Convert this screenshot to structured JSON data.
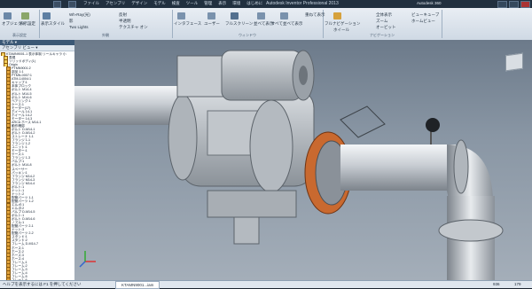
{
  "window": {
    "title": "Autodesk Inventor Professional 2013   ",
    "menus": [
      "ファイル",
      "アセンブリ",
      "デザイン",
      "モデル",
      "検査",
      "ツール",
      "管理",
      "表示",
      "環境",
      "はじめに"
    ],
    "right_label": "Autodesk 360"
  },
  "ribbon": {
    "groups": [
      {
        "title": "表示設定",
        "buttons": [
          "オブジェクト",
          "表示設定"
        ]
      },
      {
        "title": "外観",
        "buttons": [
          "表示スタイル",
          "Wh-Ray(光)",
          "影",
          "Two Lights",
          "反射",
          "半透明",
          "テクスチャ オン"
        ]
      },
      {
        "title": "ウィンドウ",
        "buttons": [
          "インタフェース",
          "ユーザー",
          "フルスクリーン",
          "並べて表示",
          "すべて並べて表示",
          "重ねて表示"
        ]
      },
      {
        "title": "ナビゲーション",
        "buttons": [
          "フルナビゲーション",
          "ホイール",
          "全体表示",
          "ズーム",
          "オービット",
          "ビューキューブ",
          "ホームビュー"
        ]
      }
    ]
  },
  "browser": {
    "header": "モデル ▾",
    "subheader": "アセンブリ ビュー ▾",
    "items": [
      "KTAMN9001-1 表示体制 リールキャラ 小",
      "表現",
      "ソリッドボディ(1)",
      "Origin",
      "PTMN9001:2",
      "部品 1:1",
      "PTMN-0007:1",
      "ATM-14004:1",
      "キャップ:1",
      "本体ブロック",
      "ボルト M14-4",
      "ボルト M14-5",
      "ボルト M14-6",
      "ベアリング:1",
      "ケース:1",
      "モーター(17)",
      "ホイール 14-1",
      "ホイール 14-2",
      "モーター 14-3",
      "ARCA ホース M14-1",
      "動作確認",
      "ボルト D-M14-1",
      "ボルト D-M14-2",
      "ストレーナ 1-1",
      "フランジ 1-1",
      "フランジ 1-2",
      "ユニット:1",
      "モーター:1",
      "ケース:1",
      "フランジ 1-3",
      "バルブ:1",
      "ボルト M14-8",
      "スペーサー",
      "パッキン:1",
      "フランジ M14-2",
      "フランジ M14-3",
      "フランジ M14-4",
      "ボルト:1",
      "ナット:1",
      "ナット:2",
      "配管パーツ 1-1",
      "配管パーツ 1-2",
      "エルボ:1",
      "エルボ:2",
      "バルブ D-M14-5",
      "ボルト:1",
      "ボルト D-M14-6",
      "ノズル:1",
      "配管パーツ 2-1",
      "ナット:3",
      "配管パーツ 2-2",
      "スタンド:1",
      "スタンド:2",
      "フレーム D-M14-7",
      "ホース:1",
      "ホース:2",
      "ホース:3",
      "ホース:4",
      "フレーム:1",
      "フレーム:2",
      "フレーム:3",
      "フレーム:4",
      "フレーム:5",
      "フレーム:6"
    ]
  },
  "status": {
    "help_text": "ヘルプを表示するには F1 を押してください",
    "tab_label": "KTAMN9001...iam",
    "num_left": "936",
    "num_right": "179"
  },
  "colors": {
    "ribbon_bg": "#dfe6ee",
    "accent": "#3b5875",
    "viewport_bg": "#8a96a3",
    "flange_orange": "#c9692f"
  },
  "icons": [
    "viewcube-icon",
    "axis-triad-icon",
    "folder-icon",
    "part-icon",
    "close-icon",
    "minimize-icon",
    "maximize-icon"
  ]
}
